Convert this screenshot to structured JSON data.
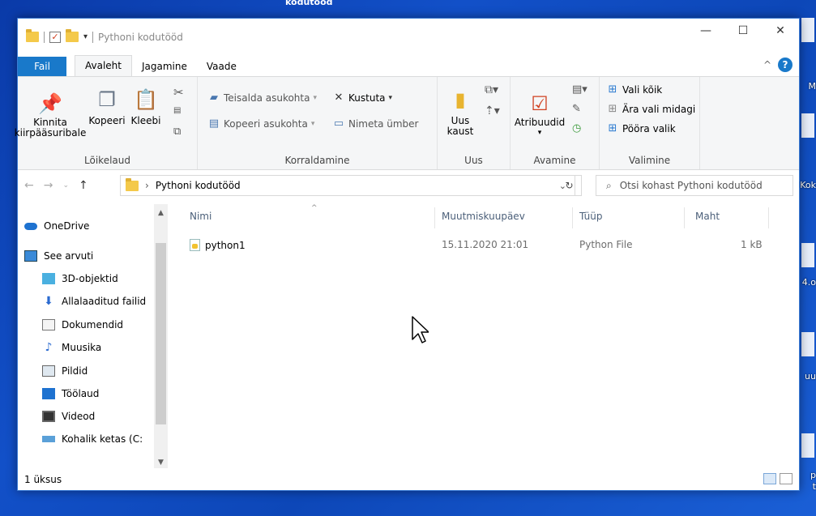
{
  "desktop": {
    "top_label": "kodutööd",
    "right_labels": [
      "M",
      "Kok",
      "4.o",
      "uu",
      "p",
      "t"
    ]
  },
  "window": {
    "title": "Pythoni kodutööd",
    "controls": {
      "minimize": "—",
      "maximize": "☐",
      "close": "✕"
    }
  },
  "ribbon_tabs": {
    "file": "Fail",
    "home": "Avaleht",
    "share": "Jagamine",
    "view": "Vaade",
    "collapse": "^",
    "help": "?"
  },
  "ribbon": {
    "clipboard": {
      "label": "Lõikelaud",
      "pin_line1": "Kinnita",
      "pin_line2": "kiirpääsuribale",
      "copy": "Kopeeri",
      "paste": "Kleebi"
    },
    "organize": {
      "label": "Korraldamine",
      "move_to": "Teisalda asukohta",
      "copy_to": "Kopeeri asukohta",
      "delete": "Kustuta",
      "rename": "Nimeta ümber"
    },
    "new": {
      "label": "Uus",
      "new_folder_line1": "Uus",
      "new_folder_line2": "kaust"
    },
    "open": {
      "label": "Avamine",
      "properties": "Atribuudid"
    },
    "select": {
      "label": "Valimine",
      "select_all": "Vali kõik",
      "select_none": "Ära vali midagi",
      "invert": "Pööra valik"
    }
  },
  "address": {
    "path": "Pythoni kodutööd",
    "search_placeholder": "Otsi kohast Pythoni kodutööd"
  },
  "nav_pane": [
    {
      "label": "OneDrive",
      "icon": "onedrive-icon"
    },
    {
      "label": "See arvuti",
      "icon": "computer-icon"
    },
    {
      "label": "3D-objektid",
      "icon": "3d-objects-icon"
    },
    {
      "label": "Allalaaditud failid",
      "icon": "downloads-icon"
    },
    {
      "label": "Dokumendid",
      "icon": "documents-icon"
    },
    {
      "label": "Muusika",
      "icon": "music-icon"
    },
    {
      "label": "Pildid",
      "icon": "pictures-icon"
    },
    {
      "label": "Töölaud",
      "icon": "desktop-icon"
    },
    {
      "label": "Videod",
      "icon": "videos-icon"
    },
    {
      "label": "Kohalik ketas (C:",
      "icon": "local-disk-icon"
    }
  ],
  "columns": {
    "name": "Nimi",
    "modified": "Muutmiskuupäev",
    "type": "Tüüp",
    "size": "Maht"
  },
  "files": [
    {
      "name": "python1",
      "modified": "15.11.2020 21:01",
      "type": "Python File",
      "size": "1 kB"
    }
  ],
  "status": {
    "count": "1 üksus"
  }
}
